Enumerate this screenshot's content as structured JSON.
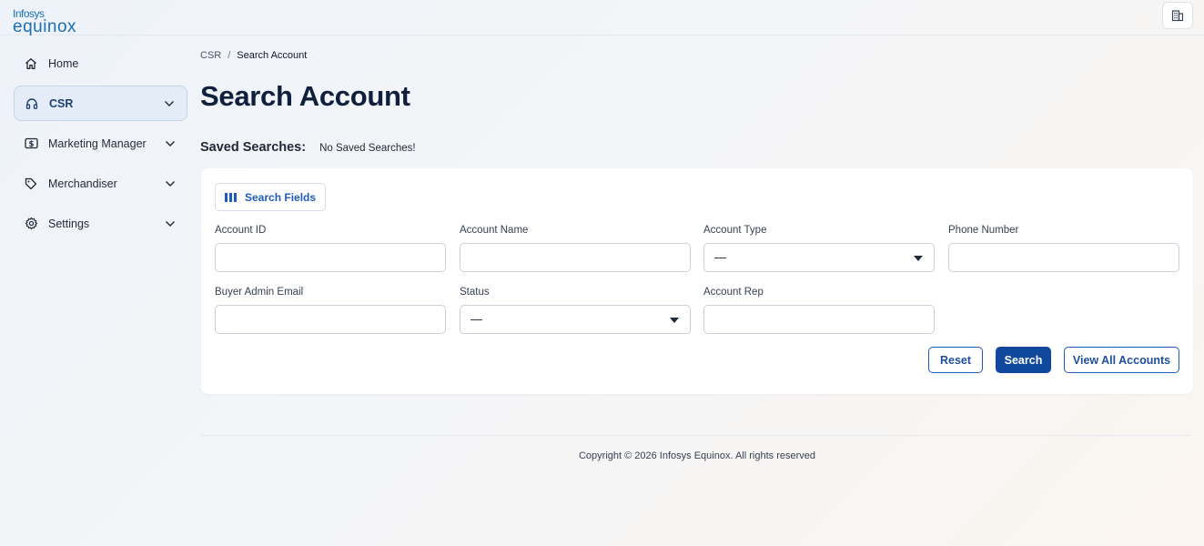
{
  "brand": {
    "line1": "Infosys",
    "line2": "equinox",
    "accent": "#1a6fb8"
  },
  "header": {
    "org_icon": "building-icon"
  },
  "sidebar": {
    "items": [
      {
        "label": "Home",
        "icon": "home-icon",
        "expandable": false,
        "active": false
      },
      {
        "label": "CSR",
        "icon": "headset-icon",
        "expandable": true,
        "active": true
      },
      {
        "label": "Marketing Manager",
        "icon": "dollar-card-icon",
        "expandable": true,
        "active": false
      },
      {
        "label": "Merchandiser",
        "icon": "tag-icon",
        "expandable": true,
        "active": false
      },
      {
        "label": "Settings",
        "icon": "gear-icon",
        "expandable": true,
        "active": false
      }
    ]
  },
  "breadcrumb": {
    "parent": "CSR",
    "separator": "/",
    "current": "Search Account"
  },
  "page": {
    "title": "Search Account"
  },
  "saved_searches": {
    "label": "Saved Searches:",
    "value": "No Saved Searches!"
  },
  "form": {
    "search_fields_label": "Search Fields",
    "fields": {
      "account_id": {
        "label": "Account ID",
        "value": ""
      },
      "account_name": {
        "label": "Account Name",
        "value": ""
      },
      "account_type": {
        "label": "Account Type",
        "selected": "—"
      },
      "phone_number": {
        "label": "Phone Number",
        "value": ""
      },
      "buyer_admin_email": {
        "label": "Buyer Admin Email",
        "value": ""
      },
      "status": {
        "label": "Status",
        "selected": "—"
      },
      "account_rep": {
        "label": "Account Rep",
        "value": ""
      }
    },
    "buttons": {
      "reset": "Reset",
      "search": "Search",
      "view_all": "View All Accounts"
    },
    "primary_color": "#10489e"
  },
  "footer": {
    "copyright": "Copyright © 2026 Infosys Equinox. All rights reserved"
  }
}
